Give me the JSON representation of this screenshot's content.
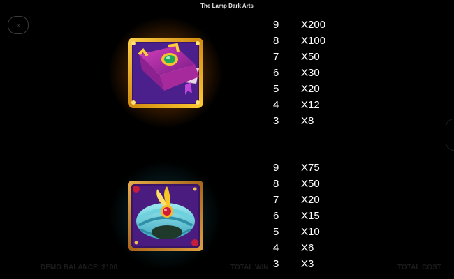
{
  "header": {
    "title": "The Lamp Dark Arts"
  },
  "controls": {
    "back_icon": "double-chevron-left-icon"
  },
  "symbols": [
    {
      "name": "spellbook",
      "glow_color": "#ff9a1a",
      "payouts": [
        {
          "count": "9",
          "mult": "X200"
        },
        {
          "count": "8",
          "mult": "X100"
        },
        {
          "count": "7",
          "mult": "X50"
        },
        {
          "count": "6",
          "mult": "X30"
        },
        {
          "count": "5",
          "mult": "X20"
        },
        {
          "count": "4",
          "mult": "X12"
        },
        {
          "count": "3",
          "mult": "X8"
        }
      ]
    },
    {
      "name": "turban",
      "glow_color": "#2aa6b8",
      "payouts": [
        {
          "count": "9",
          "mult": "X75"
        },
        {
          "count": "8",
          "mult": "X50"
        },
        {
          "count": "7",
          "mult": "X20"
        },
        {
          "count": "6",
          "mult": "X15"
        },
        {
          "count": "5",
          "mult": "X10"
        },
        {
          "count": "4",
          "mult": "X6"
        },
        {
          "count": "3",
          "mult": "X3"
        }
      ]
    }
  ],
  "footer": {
    "balance": "DEMO BALANCE: $100",
    "win": "TOTAL WIN",
    "cost": "TOTAL COST"
  }
}
